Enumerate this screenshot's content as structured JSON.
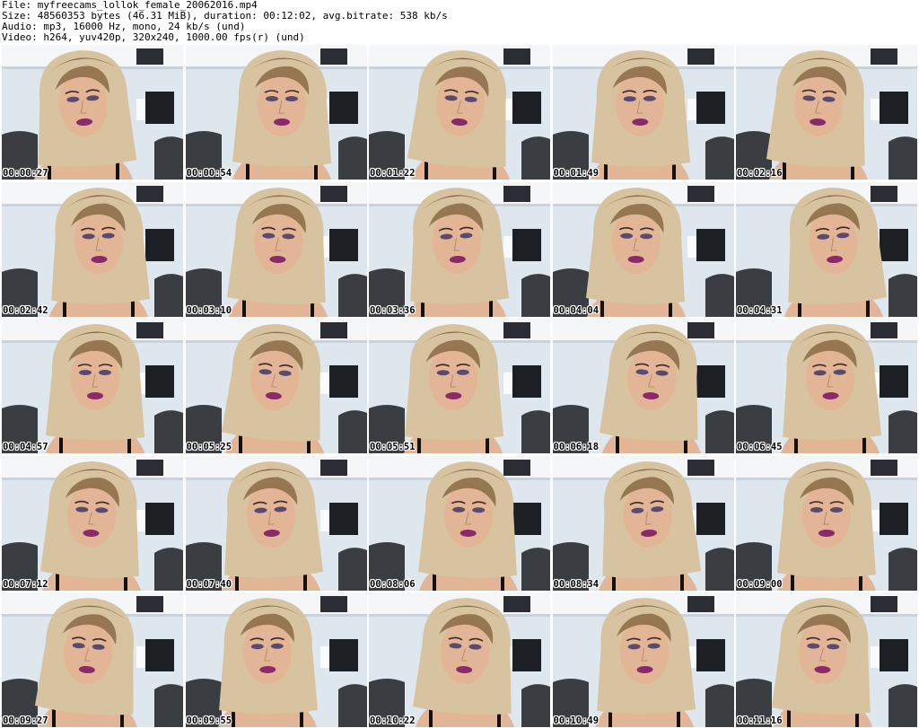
{
  "header": {
    "file_line": "File: myfreecams_lollok_female_20062016.mp4",
    "size_line": "Size: 48560353 bytes (46.31 MiB), duration: 00:12:02, avg.bitrate: 538 kb/s",
    "audio_line": "Audio: mp3, 16000 Hz, mono, 24 kb/s (und)",
    "video_line": "Video: h264, yuv420p, 320x240, 1000.00 fps(r) (und)"
  },
  "colors": {
    "background": "#ffffff",
    "wall": "#dfe7ee",
    "shelf": "#f4f6f7",
    "dark_panel": "#1c1f24",
    "hair_light": "#d8c3a0",
    "hair_dark": "#8a6a44",
    "skin": "#e2b596",
    "lips": "#8a2a6a",
    "chair": "#3a3d42"
  },
  "thumbnails": [
    {
      "timestamp": "00:00:27",
      "icon": "video-frame-thumbnail"
    },
    {
      "timestamp": "00:00:54",
      "icon": "video-frame-thumbnail"
    },
    {
      "timestamp": "00:01:22",
      "icon": "video-frame-thumbnail"
    },
    {
      "timestamp": "00:01:49",
      "icon": "video-frame-thumbnail"
    },
    {
      "timestamp": "00:02:16",
      "icon": "video-frame-thumbnail"
    },
    {
      "timestamp": "00:02:42",
      "icon": "video-frame-thumbnail"
    },
    {
      "timestamp": "00:03:10",
      "icon": "video-frame-thumbnail"
    },
    {
      "timestamp": "00:03:36",
      "icon": "video-frame-thumbnail"
    },
    {
      "timestamp": "00:04:04",
      "icon": "video-frame-thumbnail"
    },
    {
      "timestamp": "00:04:31",
      "icon": "video-frame-thumbnail"
    },
    {
      "timestamp": "00:04:57",
      "icon": "video-frame-thumbnail"
    },
    {
      "timestamp": "00:05:25",
      "icon": "video-frame-thumbnail"
    },
    {
      "timestamp": "00:05:51",
      "icon": "video-frame-thumbnail"
    },
    {
      "timestamp": "00:06:18",
      "icon": "video-frame-thumbnail"
    },
    {
      "timestamp": "00:06:45",
      "icon": "video-frame-thumbnail"
    },
    {
      "timestamp": "00:07:12",
      "icon": "video-frame-thumbnail"
    },
    {
      "timestamp": "00:07:40",
      "icon": "video-frame-thumbnail"
    },
    {
      "timestamp": "00:08:06",
      "icon": "video-frame-thumbnail"
    },
    {
      "timestamp": "00:08:34",
      "icon": "video-frame-thumbnail"
    },
    {
      "timestamp": "00:09:00",
      "icon": "video-frame-thumbnail"
    },
    {
      "timestamp": "00:09:27",
      "icon": "video-frame-thumbnail"
    },
    {
      "timestamp": "00:09:55",
      "icon": "video-frame-thumbnail"
    },
    {
      "timestamp": "00:10:22",
      "icon": "video-frame-thumbnail"
    },
    {
      "timestamp": "00:10:49",
      "icon": "video-frame-thumbnail"
    },
    {
      "timestamp": "00:11:16",
      "icon": "video-frame-thumbnail"
    }
  ]
}
